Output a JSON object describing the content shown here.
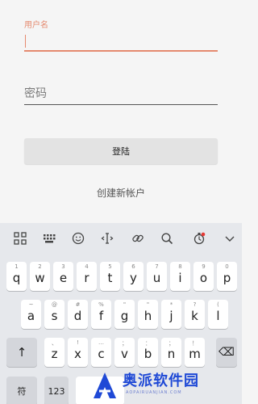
{
  "form": {
    "username_label": "用户名",
    "username_value": "",
    "password_placeholder": "密码",
    "login_button": "登陆",
    "create_account_link": "创建新帐户"
  },
  "keyboard": {
    "row1": [
      {
        "ch": "q",
        "hint": "1"
      },
      {
        "ch": "w",
        "hint": "2"
      },
      {
        "ch": "e",
        "hint": "3"
      },
      {
        "ch": "r",
        "hint": "4"
      },
      {
        "ch": "t",
        "hint": "5"
      },
      {
        "ch": "y",
        "hint": "6"
      },
      {
        "ch": "u",
        "hint": "7"
      },
      {
        "ch": "i",
        "hint": "8"
      },
      {
        "ch": "o",
        "hint": "9"
      },
      {
        "ch": "p",
        "hint": "0"
      }
    ],
    "row2": [
      {
        "ch": "a",
        "hint": "~"
      },
      {
        "ch": "s",
        "hint": "@"
      },
      {
        "ch": "d",
        "hint": "#"
      },
      {
        "ch": "f",
        "hint": "%"
      },
      {
        "ch": "g",
        "hint": "\""
      },
      {
        "ch": "h",
        "hint": "\""
      },
      {
        "ch": "j",
        "hint": "*"
      },
      {
        "ch": "k",
        "hint": "?"
      },
      {
        "ch": "l",
        "hint": "("
      }
    ],
    "row3": [
      {
        "ch": "z",
        "hint": "、"
      },
      {
        "ch": "x",
        "hint": "!"
      },
      {
        "ch": "c",
        "hint": "…"
      },
      {
        "ch": "v",
        "hint": "；"
      },
      {
        "ch": "b",
        "hint": "："
      },
      {
        "ch": "n",
        "hint": "；"
      },
      {
        "ch": "m",
        "hint": "！"
      }
    ],
    "shift": "↑",
    "backspace": "⌫",
    "symbol_key": "符",
    "number_key": "123"
  },
  "toolbar_icons": [
    "grid-icon",
    "keyboard-icon",
    "emoji-icon",
    "cursor-icon",
    "link-icon",
    "search-icon",
    "settings-icon",
    "chevron-down-icon"
  ],
  "watermark": {
    "text": "奥派软件园",
    "sub": "AOPAIRUANJIAN.COM"
  },
  "colors": {
    "accent": "#e58a6f",
    "watermark": "#1f49d6",
    "notification_dot": "#e53935"
  }
}
